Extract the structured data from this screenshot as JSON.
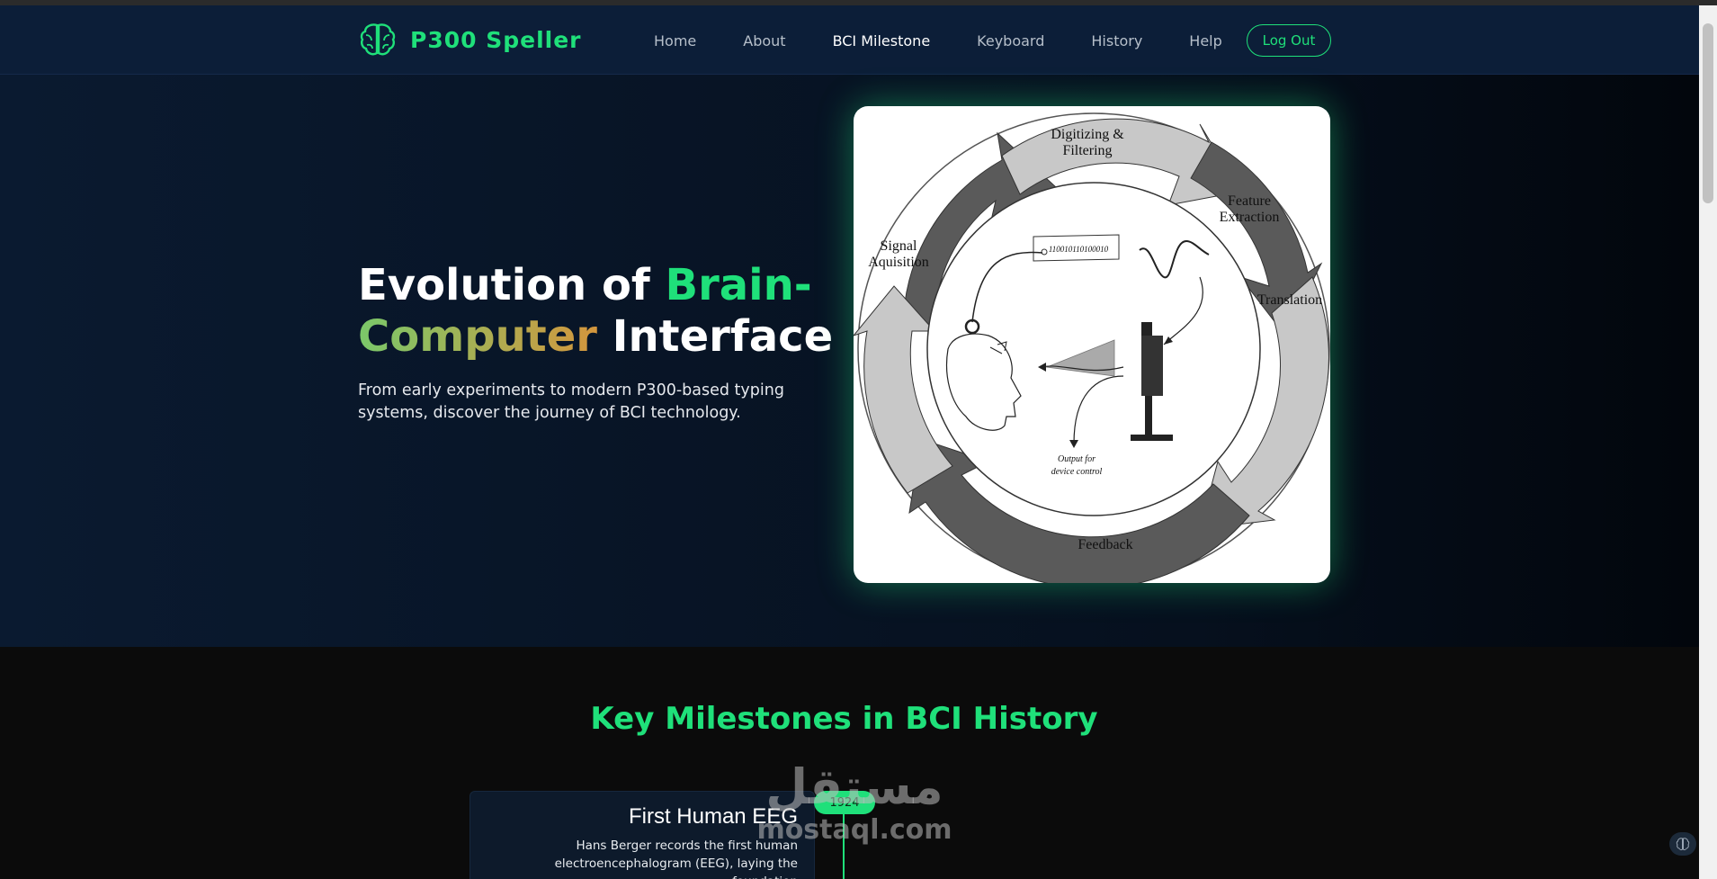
{
  "app": {
    "name": "P300 Speller"
  },
  "nav": {
    "items": [
      "Home",
      "About",
      "BCI Milestone",
      "Keyboard",
      "History",
      "Help"
    ],
    "active": "BCI Milestone",
    "logout_label": "Log Out"
  },
  "hero": {
    "title_part1": "Evolution of ",
    "title_part2": "Brain-",
    "title_part3": "Computer",
    "title_part4": " Interface",
    "subtitle": "From early experiments to modern P300-based typing systems, discover the journey of BCI technology."
  },
  "diagram": {
    "labels": {
      "digitizing_1": "Digitizing &",
      "digitizing_2": "Filtering",
      "feature_1": "Feature",
      "feature_2": "Extraction",
      "signal_1": "Signal",
      "signal_2": "Aquisition",
      "translation": "Translation",
      "feedback": "Feedback",
      "binary": "110010110100010",
      "output_1": "Output for",
      "output_2": "device control"
    }
  },
  "milestones": {
    "title": "Key Milestones in BCI History",
    "items": [
      {
        "year": "1924",
        "title": "First Human EEG",
        "text": "Hans Berger records the first human electroencephalogram (EEG), laying the foundation"
      }
    ]
  },
  "watermark": {
    "ar": "مستقل",
    "en": "mostaql.com"
  },
  "colors": {
    "accent": "#1fe07a",
    "nav_bg": "#0c1e38",
    "page_bg": "#0b0b0b"
  },
  "icons": {
    "logo": "brain-icon",
    "corner": "brain-icon"
  }
}
